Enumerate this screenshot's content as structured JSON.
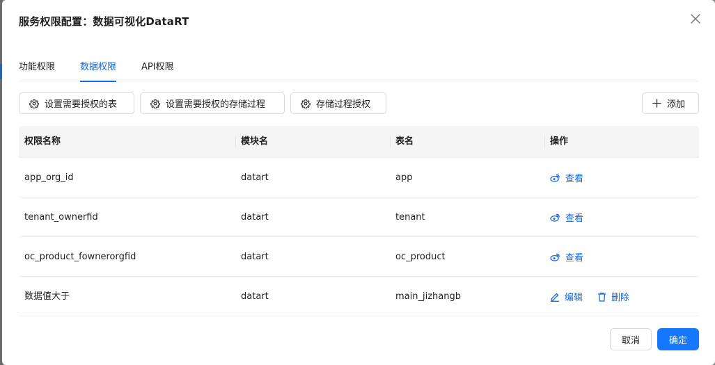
{
  "dialog": {
    "title": "服务权限配置：数据可视化DataRT"
  },
  "tabs": [
    {
      "label": "功能权限",
      "active": false
    },
    {
      "label": "数据权限",
      "active": true
    },
    {
      "label": "API权限",
      "active": false
    }
  ],
  "toolbar": {
    "set_tables_label": "设置需要授权的表",
    "set_procedures_label": "设置需要授权的存储过程",
    "procedure_auth_label": "存储过程授权",
    "add_label": "添加"
  },
  "table": {
    "columns": [
      "权限名称",
      "模块名",
      "表名",
      "操作"
    ],
    "rows": [
      {
        "name": "app_org_id",
        "module": "datart",
        "table": "app",
        "actions": [
          "查看"
        ]
      },
      {
        "name": "tenant_ownerfid",
        "module": "datart",
        "table": "tenant",
        "actions": [
          "查看"
        ]
      },
      {
        "name": "oc_product_fownerorgfid",
        "module": "datart",
        "table": "oc_product",
        "actions": [
          "查看"
        ]
      },
      {
        "name": "数据值大于",
        "module": "datart",
        "table": "main_jizhangb",
        "actions": [
          "编辑",
          "删除"
        ]
      }
    ]
  },
  "footer": {
    "cancel_label": "取消",
    "ok_label": "确定"
  },
  "colors": {
    "primary": "#1677ff",
    "link": "#1668dc",
    "header_bg": "#f5f5f5"
  },
  "icons": {
    "toolbar": "gear-icon",
    "add": "plus-icon",
    "view": "weibo-eye-icon",
    "edit": "edit-icon",
    "delete": "trash-icon",
    "close": "close-icon"
  }
}
